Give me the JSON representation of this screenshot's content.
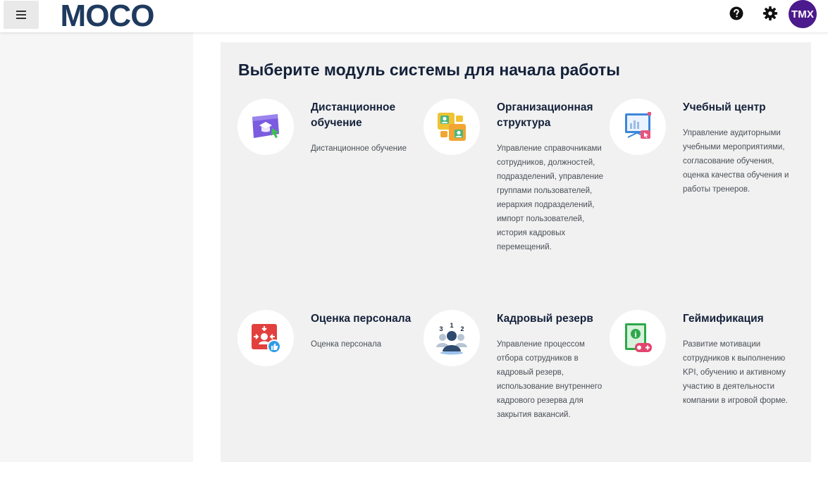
{
  "header": {
    "logo_text": "MOCO",
    "avatar_initials": "TMX",
    "brand_color": "#1f3a5f",
    "avatar_color": "#4b1a8c"
  },
  "main": {
    "title": "Выберите модуль системы для начала работы",
    "modules": [
      {
        "title": "Дистанционное обучение",
        "description": "Дистанционное обучение",
        "icon": "remote-learning-icon"
      },
      {
        "title": "Организационная структура",
        "description": "Управление справочниками сотрудников, должностей, подразделений, управление группами пользователей, иерархия подразделений, импорт пользователей, история кадровых перемещений.",
        "icon": "org-structure-icon"
      },
      {
        "title": "Учебный центр",
        "description": "Управление аудиторными учебными мероприятиями, согласование обучения, оценка качества обучения и работы тренеров.",
        "icon": "training-center-icon"
      },
      {
        "title": "Оценка персонала",
        "description": "Оценка персонала",
        "icon": "staff-assessment-icon"
      },
      {
        "title": "Кадровый резерв",
        "description": "Управление процессом отбора сотрудников в кадровый резерв, использование внутреннего кадрового резерва для закрытия вакансий.",
        "icon": "talent-pool-icon"
      },
      {
        "title": "Геймификация",
        "description": "Развитие мотивации сотрудников к выполнению KPI, обучению и активному участию в деятельности компании в игровой форме.",
        "icon": "gamification-icon"
      }
    ]
  }
}
